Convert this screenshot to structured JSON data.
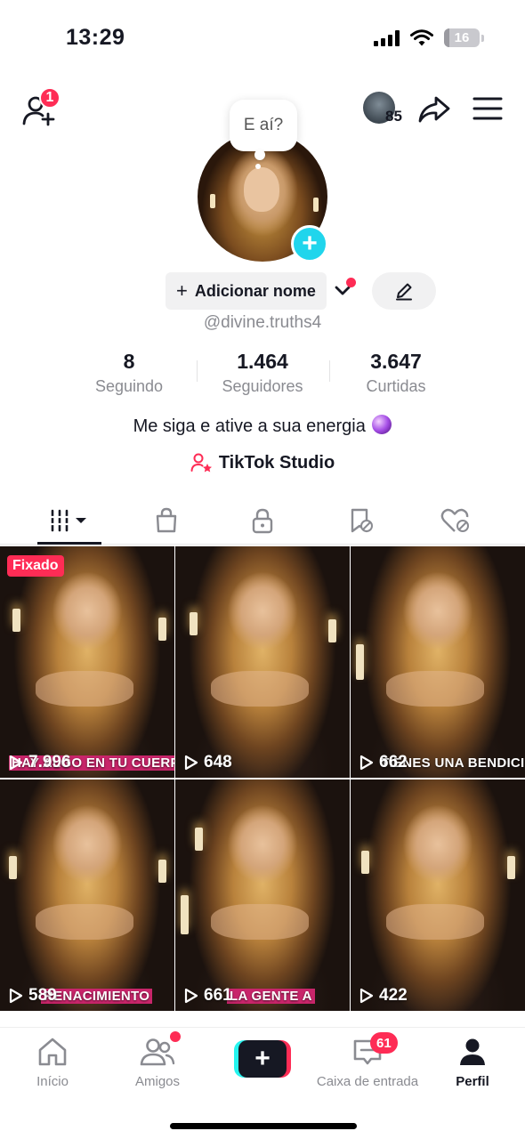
{
  "status_bar": {
    "time": "13:29",
    "battery": "16"
  },
  "top_nav": {
    "add_friend_badge": "1",
    "profile_views": "85"
  },
  "profile": {
    "bubble_text": "E aí?",
    "add_name_label": "Adicionar nome",
    "username": "@divine.truths4",
    "stats": [
      {
        "value": "8",
        "label": "Seguindo"
      },
      {
        "value": "1.464",
        "label": "Seguidores"
      },
      {
        "value": "3.647",
        "label": "Curtidas"
      }
    ],
    "bio": "Me siga e ative a sua energia",
    "studio_label": "TikTok Studio"
  },
  "tabs": [
    "videos-grid",
    "shop",
    "private",
    "favorites",
    "liked"
  ],
  "videos": [
    {
      "views": "7.996",
      "caption": "HAY ALGO EN TU CUERPO QUE",
      "pinned_label": "Fixado"
    },
    {
      "views": "648",
      "caption": ""
    },
    {
      "views": "662",
      "caption": "TIENES UNA BENDICIÓN"
    },
    {
      "views": "589",
      "caption": "RENACIMIENTO"
    },
    {
      "views": "661",
      "caption": "LA GENTE A"
    },
    {
      "views": "422",
      "caption": ""
    }
  ],
  "bottom_nav": {
    "home": "Início",
    "friends": "Amigos",
    "inbox": "Caixa de entrada",
    "inbox_badge": "61",
    "profile": "Perfil"
  },
  "colors": {
    "accent": "#fe2c55",
    "cyan": "#20d5ec",
    "text": "#161823",
    "muted": "#8a8b91"
  }
}
